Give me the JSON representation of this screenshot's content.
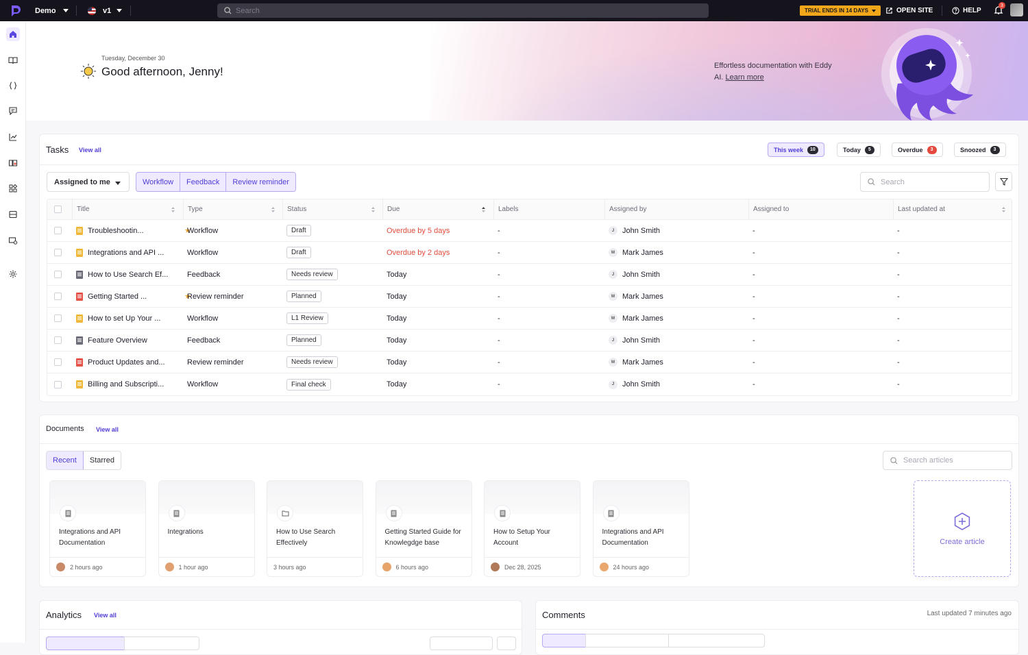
{
  "topbar": {
    "project": "Demo",
    "version": "v1",
    "search_placeholder": "Search",
    "trial": "TRIAL ENDS IN 14 DAYS",
    "open_site": "OPEN SITE",
    "help": "HELP",
    "notifications": "3"
  },
  "hero": {
    "date": "Tuesday, December 30",
    "greeting": "Good afternoon, Jenny!",
    "promo_text": "Effortless documentation with Eddy AI.",
    "promo_link": "Learn more"
  },
  "tasks": {
    "title": "Tasks",
    "view_all": "View all",
    "filters": [
      {
        "label": "This week",
        "count": "10"
      },
      {
        "label": "Today",
        "count": "5"
      },
      {
        "label": "Overdue",
        "count": "3"
      },
      {
        "label": "Snoozed",
        "count": "3"
      }
    ],
    "assigned": "Assigned to me",
    "types": [
      "Workflow",
      "Feedback",
      "Review reminder"
    ],
    "search_placeholder": "Search",
    "columns": [
      "Title",
      "Type",
      "Status",
      "Due",
      "Labels",
      "Assigned by",
      "Assigned to",
      "Last updated at"
    ],
    "rows": [
      {
        "title": "Troubleshootin...",
        "doc": "y",
        "starred": true,
        "type": "Workflow",
        "status": "Draft",
        "due": "Overdue by 5 days",
        "overdue": true,
        "labels": "-",
        "initial": "J",
        "by": "John Smith",
        "to": "-",
        "updated": "-"
      },
      {
        "title": "Integrations and API ...",
        "doc": "y",
        "starred": false,
        "type": "Workflow",
        "status": "Draft",
        "due": "Overdue by 2 days",
        "overdue": true,
        "labels": "-",
        "initial": "M",
        "by": "Mark James",
        "to": "-",
        "updated": "-"
      },
      {
        "title": "How to Use Search Ef...",
        "doc": "g",
        "starred": false,
        "type": "Feedback",
        "status": "Needs review",
        "due": "Today",
        "overdue": false,
        "labels": "-",
        "initial": "J",
        "by": "John Smith",
        "to": "-",
        "updated": "-"
      },
      {
        "title": "Getting Started ...",
        "doc": "r",
        "starred": true,
        "type": "Review reminder",
        "status": "Planned",
        "due": "Today",
        "overdue": false,
        "labels": "-",
        "initial": "M",
        "by": "Mark James",
        "to": "-",
        "updated": "-"
      },
      {
        "title": "How to set Up Your ...",
        "doc": "y",
        "starred": false,
        "type": "Workflow",
        "status": "L1 Review",
        "due": "Today",
        "overdue": false,
        "labels": "-",
        "initial": "M",
        "by": "Mark James",
        "to": "-",
        "updated": "-"
      },
      {
        "title": "Feature Overview",
        "doc": "g",
        "starred": false,
        "type": "Feedback",
        "status": "Planned",
        "due": "Today",
        "overdue": false,
        "labels": "-",
        "initial": "J",
        "by": "John Smith",
        "to": "-",
        "updated": "-"
      },
      {
        "title": "Product Updates and...",
        "doc": "r",
        "starred": false,
        "type": "Review reminder",
        "status": "Needs review",
        "due": "Today",
        "overdue": false,
        "labels": "-",
        "initial": "M",
        "by": "Mark James",
        "to": "-",
        "updated": "-"
      },
      {
        "title": "Billing and Subscripti...",
        "doc": "y",
        "starred": false,
        "type": "Workflow",
        "status": "Final check",
        "due": "Today",
        "overdue": false,
        "labels": "-",
        "initial": "J",
        "by": "John Smith",
        "to": "-",
        "updated": "-"
      }
    ]
  },
  "documents": {
    "title": "Documents",
    "view_all": "View all",
    "tabs": [
      "Recent",
      "Starred"
    ],
    "search_placeholder": "Search articles",
    "cards": [
      {
        "title": "Integrations and API Documentation",
        "time": "2 hours ago",
        "icon": "doc"
      },
      {
        "title": "Integrations",
        "time": "1 hour ago",
        "icon": "doc"
      },
      {
        "title": "How to Use Search Effectively",
        "time": "3 hours ago",
        "icon": "folder"
      },
      {
        "title": "Getting Started Guide for Knowlegdge base",
        "time": "6 hours ago",
        "icon": "doc"
      },
      {
        "title": "How to Setup Your Account",
        "time": "Dec 28, 2025",
        "icon": "doc"
      },
      {
        "title": "Integrations and API Documentation",
        "time": "24 hours ago",
        "icon": "doc"
      }
    ],
    "create": "Create article"
  },
  "analytics": {
    "title": "Analytics",
    "view_all": "View all"
  },
  "comments": {
    "title": "Comments",
    "updated": "Last updated 7 minutes ago"
  },
  "colors": {
    "accent": "#4f3dd6",
    "overdue": "#e14b3c",
    "trial": "#f2a71b"
  }
}
